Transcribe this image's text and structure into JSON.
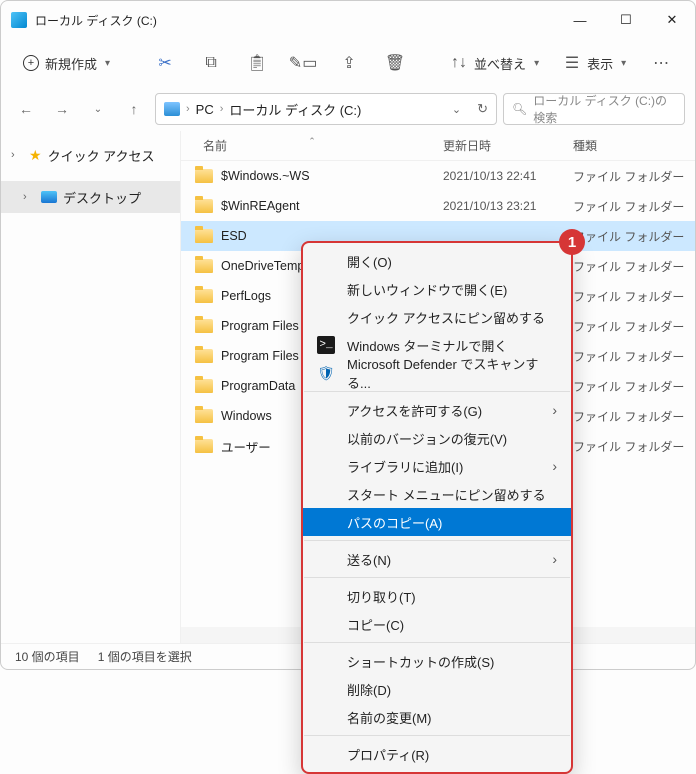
{
  "window": {
    "title": "ローカル ディスク (C:)"
  },
  "toolbar": {
    "new_label": "新規作成",
    "sort_label": "並べ替え",
    "view_label": "表示"
  },
  "nav": {
    "crumbs": [
      "PC",
      "ローカル ディスク (C:)"
    ],
    "search_placeholder": "ローカル ディスク (C:)の検索"
  },
  "sidebar": {
    "quick_access": "クイック アクセス",
    "desktop": "デスクトップ"
  },
  "headers": {
    "name": "名前",
    "date": "更新日時",
    "type": "種類"
  },
  "type_folder": "ファイル フォルダー",
  "rows": [
    {
      "name": "$Windows.~WS",
      "date": "2021/10/13 22:41",
      "selected": false
    },
    {
      "name": "$WinREAgent",
      "date": "2021/10/13 23:21",
      "selected": false
    },
    {
      "name": "ESD",
      "date": "",
      "selected": true
    },
    {
      "name": "OneDriveTemp",
      "date": "",
      "selected": false
    },
    {
      "name": "PerfLogs",
      "date": "",
      "selected": false
    },
    {
      "name": "Program Files",
      "date": "",
      "selected": false
    },
    {
      "name": "Program Files (x",
      "date": "",
      "selected": false
    },
    {
      "name": "ProgramData",
      "date": "",
      "selected": false
    },
    {
      "name": "Windows",
      "date": "",
      "selected": false
    },
    {
      "name": "ユーザー",
      "date": "",
      "selected": false
    }
  ],
  "context_menu": {
    "badge": "1",
    "items": [
      {
        "label": "開く(O)"
      },
      {
        "label": "新しいウィンドウで開く(E)"
      },
      {
        "label": "クイック アクセスにピン留めする"
      },
      {
        "label": "Windows ターミナルで開く",
        "icon": "terminal"
      },
      {
        "label": "Microsoft Defender でスキャンする...",
        "icon": "defender"
      },
      {
        "sep": true
      },
      {
        "label": "アクセスを許可する(G)",
        "submenu": true
      },
      {
        "label": "以前のバージョンの復元(V)"
      },
      {
        "label": "ライブラリに追加(I)",
        "submenu": true
      },
      {
        "label": "スタート メニューにピン留めする"
      },
      {
        "label": "パスのコピー(A)",
        "highlighted": true
      },
      {
        "sep": true
      },
      {
        "label": "送る(N)",
        "submenu": true
      },
      {
        "sep": true
      },
      {
        "label": "切り取り(T)"
      },
      {
        "label": "コピー(C)"
      },
      {
        "sep": true
      },
      {
        "label": "ショートカットの作成(S)"
      },
      {
        "label": "削除(D)"
      },
      {
        "label": "名前の変更(M)"
      },
      {
        "sep": true
      },
      {
        "label": "プロパティ(R)"
      }
    ]
  },
  "status": {
    "item_count": "10 個の項目",
    "selection": "1 個の項目を選択"
  }
}
